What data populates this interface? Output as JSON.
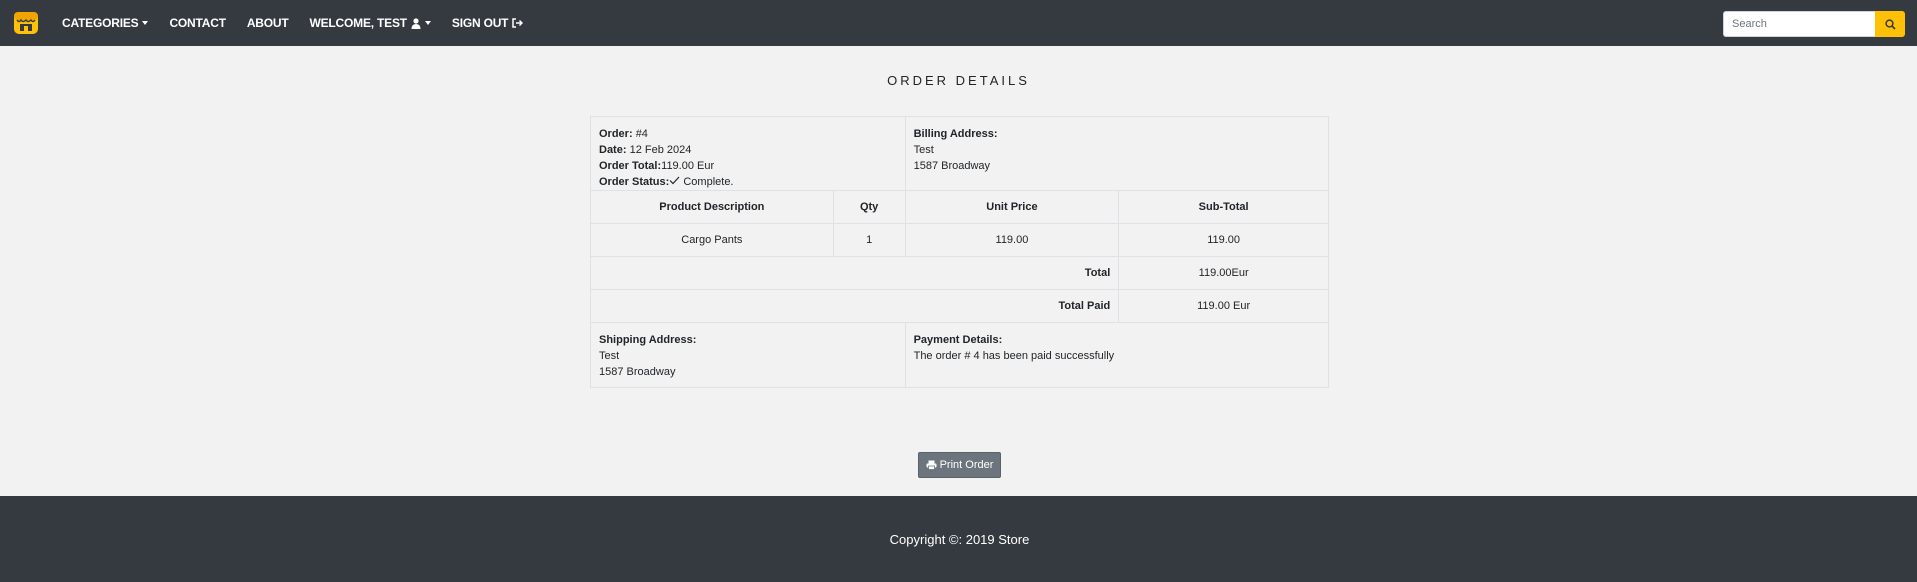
{
  "nav": {
    "items": [
      {
        "label": "CATEGORIES",
        "dropdown": true
      },
      {
        "label": "CONTACT"
      },
      {
        "label": "ABOUT"
      },
      {
        "label": "WELCOME, TEST",
        "dropdown": true,
        "icon": "user-icon"
      },
      {
        "label": "SIGN OUT",
        "icon": "sign-out-icon"
      }
    ],
    "search_placeholder": "Search"
  },
  "page": {
    "title": "ORDER DETAILS"
  },
  "order": {
    "order_label": "Order:",
    "order_value": "#4",
    "date_label": "Date:",
    "date_value": "12 Feb 2024",
    "total_label": "Order Total:",
    "total_value": "119.00 Eur",
    "status_label": "Order Status:",
    "status_value": "Complete.",
    "billing_label": "Billing Address:",
    "billing_name": "Test",
    "billing_street": "1587 Broadway"
  },
  "table": {
    "headers": [
      "Product Description",
      "Qty",
      "Unit Price",
      "Sub-Total"
    ],
    "rows": [
      {
        "description": "Cargo Pants",
        "qty": "1",
        "unit_price": "119.00",
        "subtotal": "119.00"
      }
    ],
    "total_label": "Total",
    "total_value": "119.00Eur",
    "total_paid_label": "Total Paid",
    "total_paid_value": "119.00 Eur"
  },
  "shipping": {
    "label": "Shipping Address:",
    "name": "Test",
    "street": "1587 Broadway"
  },
  "payment": {
    "label": "Payment Details:",
    "text": "The order # 4 has been paid successfully"
  },
  "print_button": "Print Order",
  "footer": {
    "copyright": "Copyright ©: 2019 Store"
  },
  "colors": {
    "navbar": "#343a40",
    "accent": "#ffc107",
    "background": "#f2f2f2",
    "button": "#6c757d"
  }
}
